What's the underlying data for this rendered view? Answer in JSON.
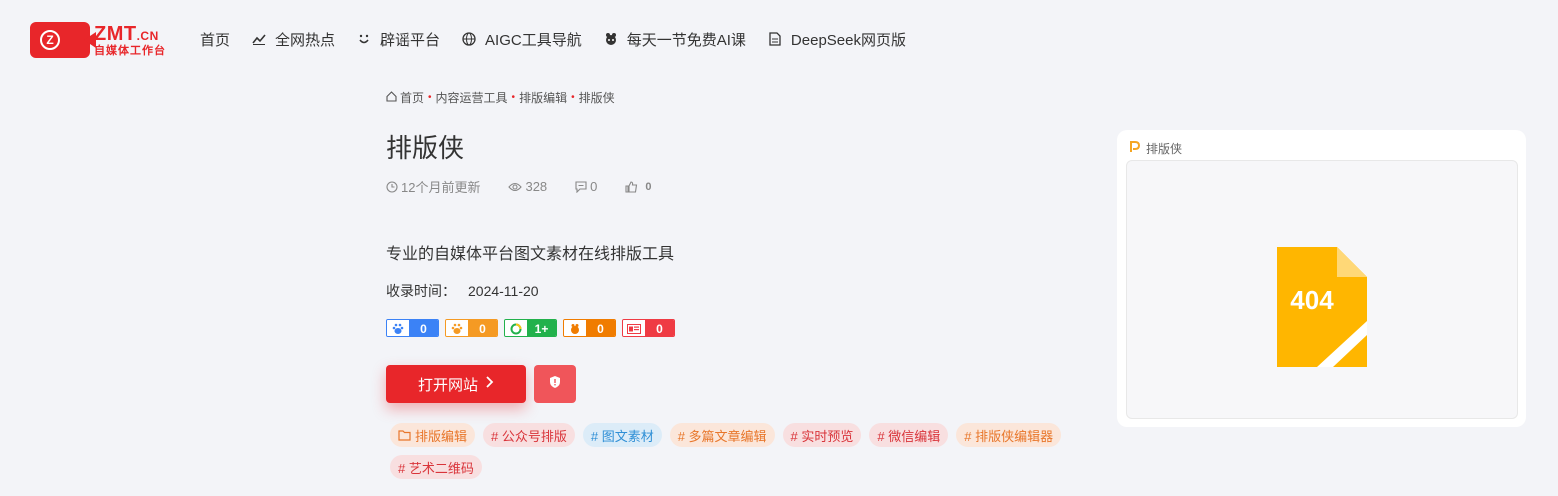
{
  "logo": {
    "main": "ZMT",
    "tld": ".CN",
    "sub": "自媒体工作台",
    "badge": "Z"
  },
  "nav": [
    {
      "label": "首页",
      "icon": ""
    },
    {
      "label": "全网热点",
      "icon": "trend-icon"
    },
    {
      "label": "辟谣平台",
      "icon": "smile-icon"
    },
    {
      "label": "AIGC工具导航",
      "icon": "globe-icon"
    },
    {
      "label": "每天一节免费AI课",
      "icon": "ai-icon"
    },
    {
      "label": "DeepSeek网页版",
      "icon": "doc-icon"
    }
  ],
  "breadcrumb": [
    "首页",
    "内容运营工具",
    "排版编辑",
    "排版侠"
  ],
  "title": "排版侠",
  "meta": {
    "updated": "12个月前更新",
    "views": "328",
    "comments": "0",
    "likes": "0"
  },
  "description": "专业的自媒体平台图文素材在线排版工具",
  "date": {
    "label": "收录时间：",
    "value": "2024-11-20"
  },
  "ranks": [
    {
      "icon": "baidu-icon",
      "value": "0",
      "color": "#3b82f6"
    },
    {
      "icon": "baidu-mobile-icon",
      "value": "0",
      "color": "#f59a23"
    },
    {
      "icon": "360-icon",
      "value": "1+",
      "color": "#22b14c"
    },
    {
      "icon": "sogou-icon",
      "value": "0",
      "color": "#f07c00"
    },
    {
      "icon": "toutiao-icon",
      "value": "0",
      "color": "#ef3b44"
    }
  ],
  "buttons": {
    "open": "打开网站"
  },
  "tags": [
    {
      "label": "排版编辑",
      "prefix": "folder",
      "color": "#e8762a",
      "bg": "#fbe6da"
    },
    {
      "label": "# 公众号排版",
      "color": "#d9343a",
      "bg": "#f8dfe0"
    },
    {
      "label": "# 图文素材",
      "color": "#2f8fd6",
      "bg": "#dcecf8"
    },
    {
      "label": "# 多篇文章编辑",
      "color": "#e8762a",
      "bg": "#fbe6da"
    },
    {
      "label": "# 实时预览",
      "color": "#d9343a",
      "bg": "#f8dfe0"
    },
    {
      "label": "# 微信编辑",
      "color": "#d9343a",
      "bg": "#f8dfe0"
    },
    {
      "label": "# 排版侠编辑器",
      "color": "#e8762a",
      "bg": "#fbe6da"
    },
    {
      "label": "# 艺术二维码",
      "color": "#d9343a",
      "bg": "#f8dfe0"
    }
  ],
  "side": {
    "title": "排版侠",
    "error": "404"
  }
}
